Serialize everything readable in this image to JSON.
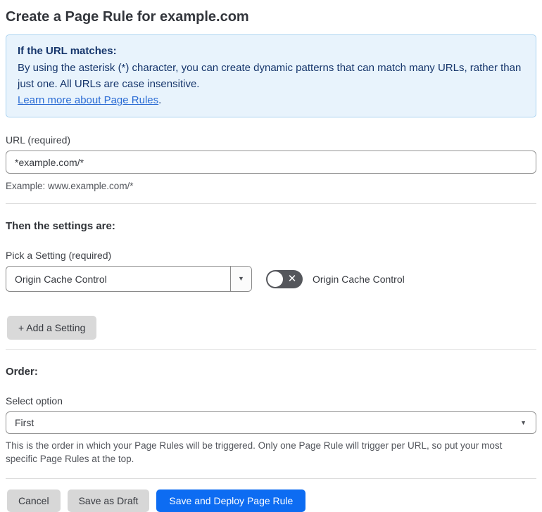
{
  "page": {
    "title": "Create a Page Rule for example.com"
  },
  "info_box": {
    "heading": "If the URL matches:",
    "body": "By using the asterisk (*) character, you can create dynamic patterns that can match many URLs, rather than just one. All URLs are case insensitive.",
    "link_text": "Learn more about Page Rules",
    "link_suffix": "."
  },
  "url_section": {
    "label": "URL (required)",
    "input_value": "*example.com/*",
    "helper": "Example: www.example.com/*"
  },
  "settings_section": {
    "heading": "Then the settings are:",
    "picker_label": "Pick a Setting (required)",
    "selected_setting": "Origin Cache Control",
    "toggle_state": "off",
    "toggle_label": "Origin Cache Control",
    "add_button_label": "+ Add a Setting"
  },
  "order_section": {
    "heading": "Order:",
    "label": "Select option",
    "selected_option": "First",
    "helper": "This is the order in which your Page Rules will be triggered. Only one Page Rule will trigger per URL, so put your most specific Page Rules at the top."
  },
  "footer": {
    "cancel_label": "Cancel",
    "save_draft_label": "Save as Draft",
    "save_deploy_label": "Save and Deploy Page Rule"
  },
  "icons": {
    "dropdown_arrow": "▼",
    "toggle_off_x": "✕"
  },
  "colors": {
    "accent_blue": "#0d6cf2",
    "info_background": "#e8f3fc",
    "info_border": "#abd3f0",
    "info_text": "#15356b",
    "link_blue": "#2b6cd4",
    "toggle_off_gray": "#55575c",
    "button_gray": "#d7d7d7"
  }
}
